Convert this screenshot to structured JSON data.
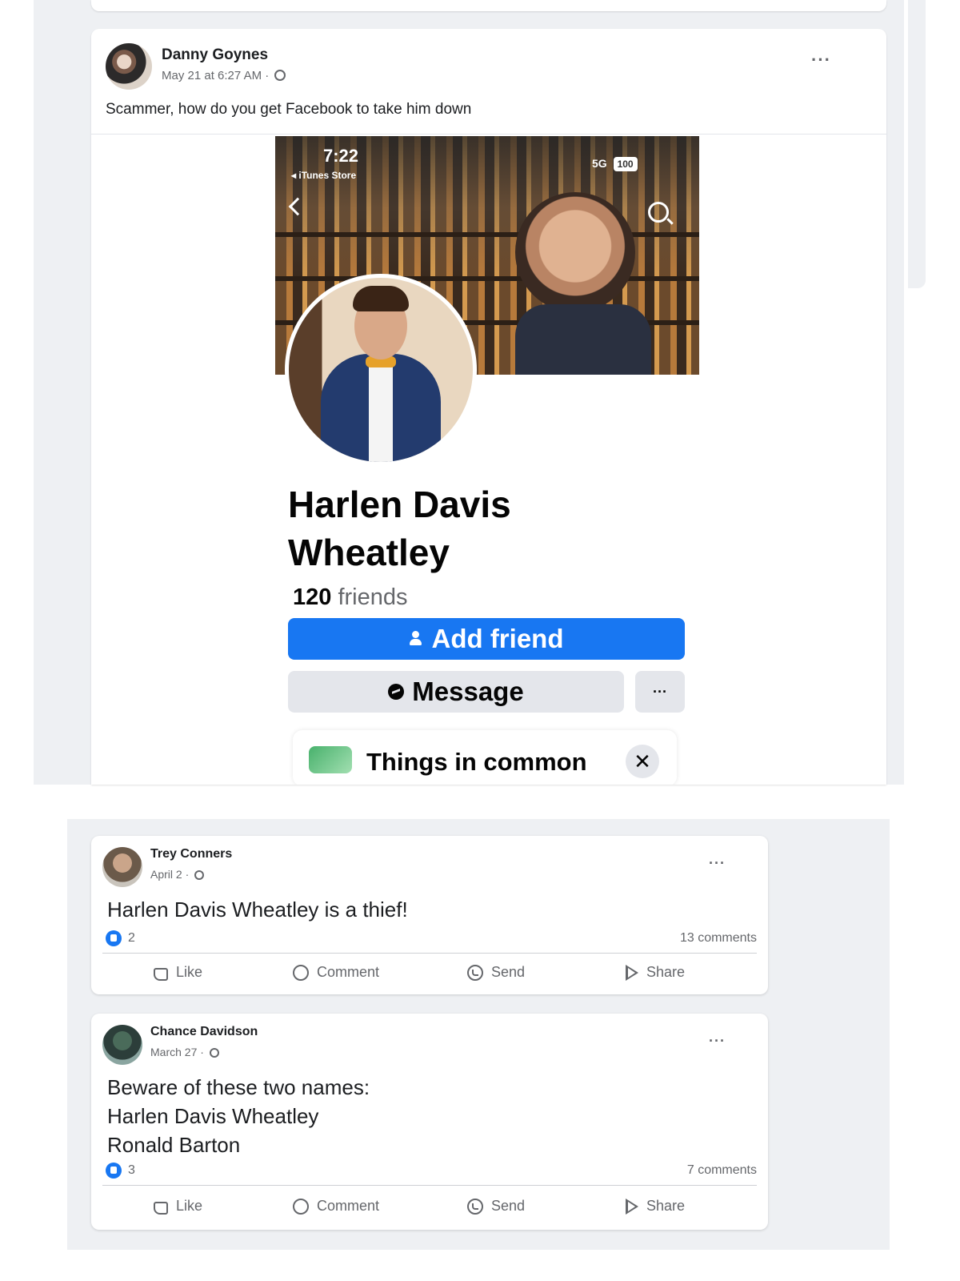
{
  "post": {
    "author": "Danny Goynes",
    "meta": "May 21 at 6:27 AM ·",
    "text": "Scammer, how do you get Facebook to take him down",
    "more_label": "···"
  },
  "screenshot": {
    "status_time": "7:22",
    "status_back": "◂ iTunes Store",
    "status_signal": "5G",
    "status_battery": "100",
    "profile_name": "Harlen Davis Wheatley",
    "friends_count": "120",
    "friends_label": "friends",
    "add_friend_label": "Add friend",
    "message_label": "Message",
    "more_label": "···",
    "things_in_common": "Things in common",
    "close_label": "✕"
  },
  "comments": [
    {
      "author": "Trey Conners",
      "meta": "April 2 ·",
      "lines": [
        "Harlen Davis Wheatley is a thief!"
      ],
      "reactions": "2",
      "comments": "13 comments"
    },
    {
      "author": "Chance Davidson",
      "meta": "March 27 ·",
      "lines": [
        "Beware of these two names:",
        "Harlen Davis Wheatley",
        "Ronald Barton"
      ],
      "reactions": "3",
      "comments": "7 comments"
    }
  ],
  "actions": {
    "like": "Like",
    "comment": "Comment",
    "send": "Send",
    "share": "Share",
    "more": "···"
  },
  "colors": {
    "accent": "#1877f2",
    "background": "#eef0f3",
    "secondary_text": "#65676b"
  }
}
